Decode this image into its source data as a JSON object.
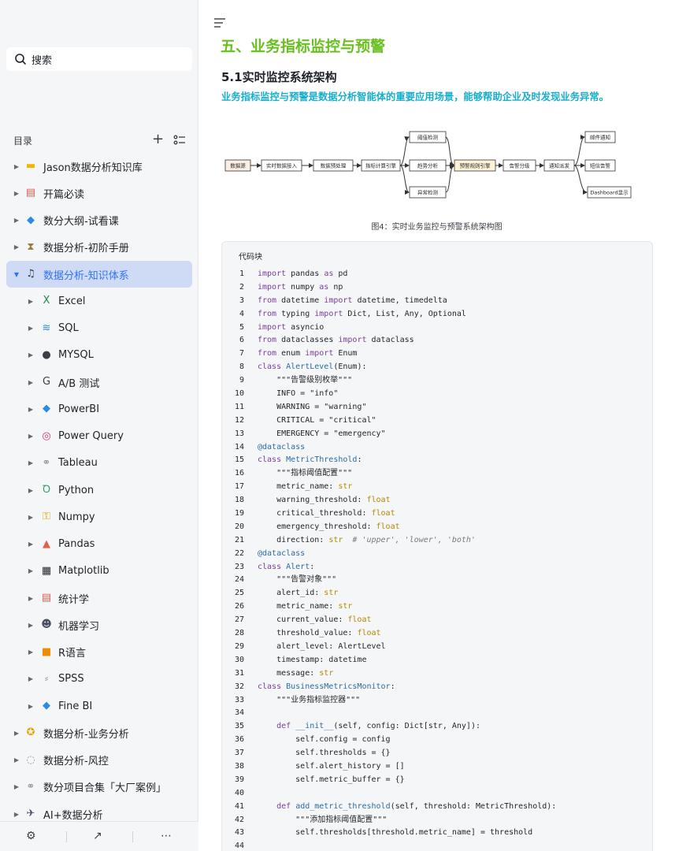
{
  "search": {
    "placeholder": "搜索"
  },
  "toc": {
    "label": "目录"
  },
  "tree": [
    {
      "level": 0,
      "label": "Jason数据分析知识库",
      "icon": "folder-icon",
      "color": "#f5b400"
    },
    {
      "level": 0,
      "label": "开篇必读",
      "icon": "document-icon",
      "color": "#e35d4a"
    },
    {
      "level": 0,
      "label": "数分大纲-试看课",
      "icon": "diamond-icon",
      "color": "#2b8ae6"
    },
    {
      "level": 0,
      "label": "数据分析-初阶手册",
      "icon": "hourglass-icon",
      "color": "#9b7a3f"
    },
    {
      "level": 0,
      "label": "数据分析-知识体系",
      "icon": "music-note-icon",
      "color": "#3a3f45",
      "active": true
    },
    {
      "level": 1,
      "label": "Excel",
      "icon": "excel-icon",
      "color": "#1d8a4c"
    },
    {
      "level": 1,
      "label": "SQL",
      "icon": "sql-icon",
      "color": "#2b8ae6"
    },
    {
      "level": 1,
      "label": "MYSQL",
      "icon": "mysql-icon",
      "color": "#3a3f45"
    },
    {
      "level": 1,
      "label": "A/B 测试",
      "icon": "ab-test-icon",
      "color": "#3a3f45"
    },
    {
      "level": 1,
      "label": "PowerBI",
      "icon": "powerbi-icon",
      "color": "#2b8ae6"
    },
    {
      "level": 1,
      "label": "Power Query",
      "icon": "power-query-icon",
      "color": "#d6336c"
    },
    {
      "level": 1,
      "label": "Tableau",
      "icon": "tableau-icon",
      "color": "#8f959e"
    },
    {
      "level": 1,
      "label": "Python",
      "icon": "python-icon",
      "color": "#2e9e6a"
    },
    {
      "level": 1,
      "label": "Numpy",
      "icon": "numpy-icon",
      "color": "#e0a800"
    },
    {
      "level": 1,
      "label": "Pandas",
      "icon": "pandas-icon",
      "color": "#e35d4a"
    },
    {
      "level": 1,
      "label": "Matplotlib",
      "icon": "matplotlib-icon",
      "color": "#1f2329"
    },
    {
      "level": 1,
      "label": "统计学",
      "icon": "statistics-icon",
      "color": "#e35d4a"
    },
    {
      "level": 1,
      "label": "机器学习",
      "icon": "robot-icon",
      "color": "#4a4f66"
    },
    {
      "level": 1,
      "label": "R语言",
      "icon": "r-icon",
      "color": "#f08c00"
    },
    {
      "level": 1,
      "label": "SPSS",
      "icon": "spss-icon",
      "color": "#8f959e"
    },
    {
      "level": 1,
      "label": "Fine BI",
      "icon": "finebi-icon",
      "color": "#2b8ae6"
    },
    {
      "level": 0,
      "label": "数据分析-业务分析",
      "icon": "medal-icon",
      "color": "#e0a800"
    },
    {
      "level": 0,
      "label": "数据分析-风控",
      "icon": "speech-bubble-icon",
      "color": "#8f959e"
    },
    {
      "level": 0,
      "label": "数分项目合集「大厂案例」",
      "icon": "link-icon",
      "color": "#8f959e"
    },
    {
      "level": 0,
      "label": "AI+数据分析",
      "icon": "ai-icon",
      "color": "#4a4f66"
    }
  ],
  "doc": {
    "h1": "五、业务指标监控与预警",
    "h2": "5.1实时监控系统架构",
    "lead": "业务指标监控与预警是数据分析智能体的重要应用场景，能够帮助企业及时发现业务异常。",
    "caption": "图4：实时业务监控与预警系统架构图"
  },
  "diagram_nodes": {
    "n1": "数据源",
    "n2": "实时数据接入",
    "n3": "数据预处理",
    "n4": "指标计算引擎",
    "n5": "阈值检测",
    "n6": "趋势分析",
    "n7": "异常检测",
    "n8": "预警规则引擎",
    "n9": "告警分级",
    "n10": "通知派发",
    "n11": "邮件通知",
    "n12": "短信告警",
    "n13": "Dashboard显示"
  },
  "code": {
    "label": "代码块",
    "lines": [
      "import pandas as pd",
      "import numpy as np",
      "from datetime import datetime, timedelta",
      "from typing import Dict, List, Any, Optional",
      "import asyncio",
      "from dataclasses import dataclass",
      "from enum import Enum",
      "class AlertLevel(Enum):",
      "    \"\"\"告警级别枚举\"\"\"",
      "    INFO = \"info\"",
      "    WARNING = \"warning\"",
      "    CRITICAL = \"critical\"",
      "    EMERGENCY = \"emergency\"",
      "@dataclass",
      "class MetricThreshold:",
      "    \"\"\"指标阈值配置\"\"\"",
      "    metric_name: str",
      "    warning_threshold: float",
      "    critical_threshold: float",
      "    emergency_threshold: float",
      "    direction: str  # 'upper', 'lower', 'both'",
      "@dataclass",
      "class Alert:",
      "    \"\"\"告警对象\"\"\"",
      "    alert_id: str",
      "    metric_name: str",
      "    current_value: float",
      "    threshold_value: float",
      "    alert_level: AlertLevel",
      "    timestamp: datetime",
      "    message: str",
      "class BusinessMetricsMonitor:",
      "    \"\"\"业务指标监控器\"\"\"",
      "",
      "    def __init__(self, config: Dict[str, Any]):",
      "        self.config = config",
      "        self.thresholds = {}",
      "        self.alert_history = []",
      "        self.metric_buffer = {}",
      "",
      "    def add_metric_threshold(self, threshold: MetricThreshold):",
      "        \"\"\"添加指标阈值配置\"\"\"",
      "        self.thresholds[threshold.metric_name] = threshold",
      ""
    ]
  }
}
